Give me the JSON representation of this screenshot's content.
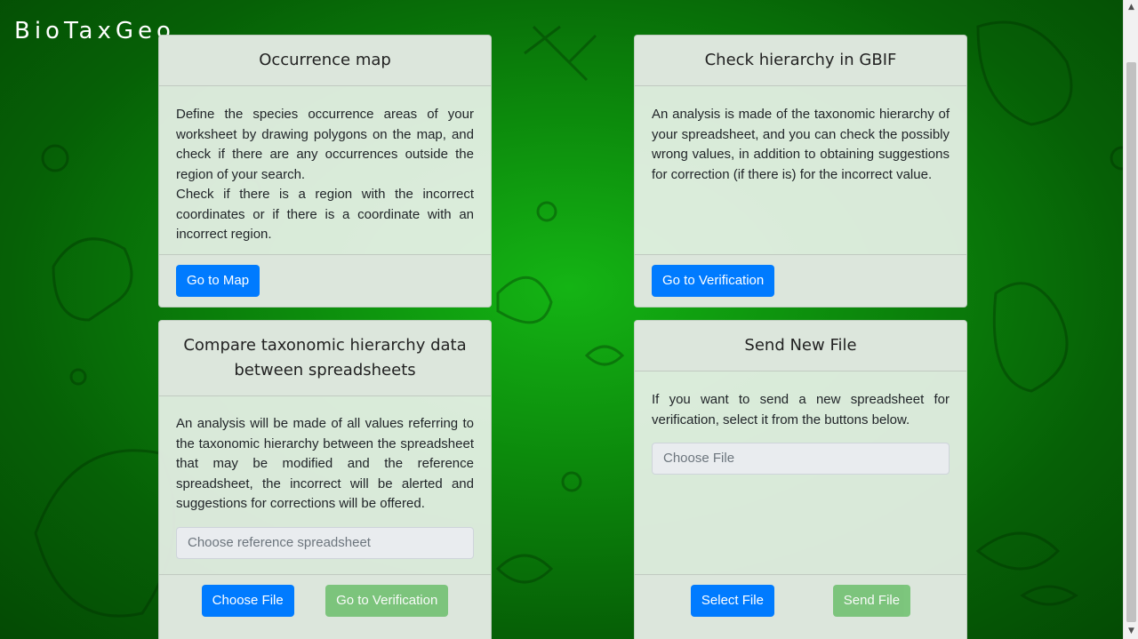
{
  "brand": {
    "title": "BioTaxGeo"
  },
  "cards": {
    "map": {
      "title": "Occurrence map",
      "paragraph1": "Define the species occurrence areas of your worksheet by drawing polygons on the map, and check if there are any occurrences outside the region of your search.",
      "paragraph2": "Check if there is a region with the incorrect coordinates or if there is a coordinate with an incorrect region.",
      "button": "Go to Map"
    },
    "gbif": {
      "title": "Check hierarchy in GBIF",
      "paragraph": "An analysis is made of the taxonomic hierarchy of your spreadsheet, and you can check the possibly wrong values, in addition to obtaining suggestions for correction (if there is) for the incorrect value.",
      "button": "Go to Verification"
    },
    "compare": {
      "title": "Compare taxonomic hierarchy data between spreadsheets",
      "paragraph": "An analysis will be made of all values referring to the taxonomic hierarchy between the spreadsheet that may be modified and the reference spreadsheet, the incorrect will be alerted and suggestions for corrections will be offered.",
      "file_placeholder": "Choose reference spreadsheet",
      "choose_button": "Choose File",
      "verify_button": "Go to Verification"
    },
    "send": {
      "title": "Send New File",
      "paragraph": "If you want to send a new spreadsheet for verification, select it from the buttons below.",
      "file_placeholder": "Choose File",
      "select_button": "Select File",
      "send_button": "Send File"
    }
  },
  "colors": {
    "primary_button": "#007bff",
    "success_button": "#6cbf6c",
    "background_green": "#0c8a0c"
  }
}
